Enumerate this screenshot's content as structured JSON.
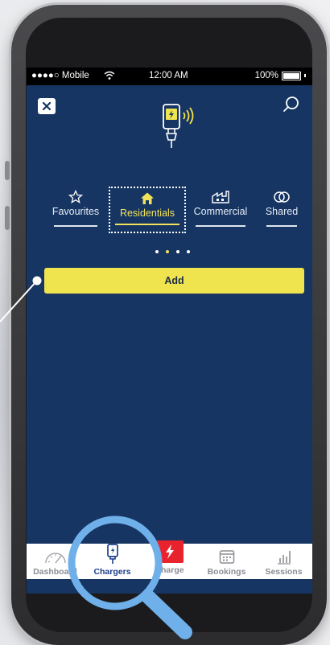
{
  "status_bar": {
    "carrier": "●●●●○ Mobile",
    "time": "12:00 AM",
    "battery": "100%"
  },
  "header": {
    "close_icon": "close-icon",
    "search_icon": "search-icon",
    "logo_icon": "ev-charger-icon"
  },
  "category_tabs": [
    {
      "label": "Favourites",
      "icon": "star-icon",
      "active": false
    },
    {
      "label": "Residentials",
      "icon": "home-icon",
      "active": true
    },
    {
      "label": "Commercial",
      "icon": "factory-icon",
      "active": false
    },
    {
      "label": "Shared",
      "icon": "link-icon",
      "active": false
    }
  ],
  "pager": {
    "count": 4,
    "active_index": 1
  },
  "add_button": {
    "label": "Add"
  },
  "tab_bar": [
    {
      "label": "Dashboard",
      "icon": "gauge-icon",
      "active": false
    },
    {
      "label": "Chargers",
      "icon": "charger-icon",
      "active": true
    },
    {
      "label": "Charge",
      "icon": "bolt-icon",
      "active": false
    },
    {
      "label": "Bookings",
      "icon": "calendar-icon",
      "active": false
    },
    {
      "label": "Sessions",
      "icon": "bar-chart-icon",
      "active": false
    }
  ],
  "colors": {
    "screen_bg": "#163563",
    "accent_yellow": "#f0e44e",
    "active_blue": "#1c3f8c",
    "charge_red": "#e8232e",
    "magnifier": "#6fb0ea"
  }
}
